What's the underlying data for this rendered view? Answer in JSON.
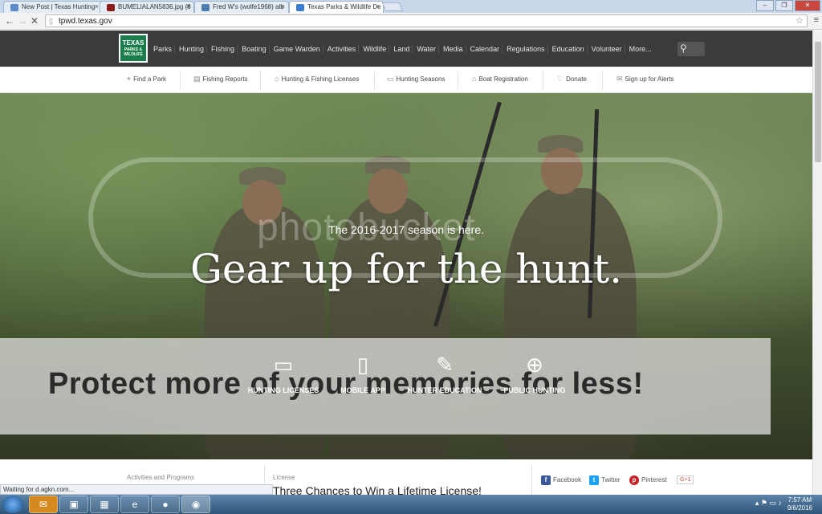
{
  "browser": {
    "tabs": [
      {
        "title": "New Post | Texas Hunting",
        "favicon_color": "#5c89c7"
      },
      {
        "title": "BUMELIALAN5836.jpg (8",
        "favicon_color": "#8b1b1b"
      },
      {
        "title": "Fred W's (wolfe1968) alb",
        "favicon_color": "#4c7fb2"
      },
      {
        "title": "Texas Parks & Wildlife De",
        "favicon_color": "#3a7bd5"
      }
    ],
    "url": "tpwd.texas.gov",
    "status_text": "Waiting for d.agkn.com..."
  },
  "site": {
    "logo": {
      "line1": "TEXAS",
      "line2": "PARKS &",
      "line3": "WILDLIFE"
    },
    "nav": [
      "Parks",
      "Hunting",
      "Fishing",
      "Boating",
      "Game Warden",
      "Activities",
      "Wildlife",
      "Land",
      "Water",
      "Media",
      "Calendar",
      "Regulations",
      "Education",
      "Volunteer",
      "More..."
    ],
    "quicklinks": [
      {
        "label": "Find a Park",
        "icon": "map-pin-icon"
      },
      {
        "label": "Fishing Reports",
        "icon": "document-icon"
      },
      {
        "label": "Hunting & Fishing Licenses",
        "icon": "tag-icon"
      },
      {
        "label": "Hunting Seasons",
        "icon": "calendar-icon"
      },
      {
        "label": "Boat Registration",
        "icon": "tag-icon"
      },
      {
        "label": "Donate",
        "icon": "heart-icon"
      },
      {
        "label": "Sign up for Alerts",
        "icon": "envelope-icon"
      }
    ]
  },
  "hero": {
    "subtitle": "The 2016-2017 season is here.",
    "title": "Gear up for the hunt.",
    "watermark": "photobucket",
    "banner": "Protect more of your memories for less!",
    "ctas": [
      {
        "label": "HUNTING LICENSES",
        "icon": "license-card-icon"
      },
      {
        "label": "MOBILE APP",
        "icon": "mobile-phone-icon"
      },
      {
        "label": "HUNTER EDUCATION",
        "icon": "pencil-edit-icon"
      },
      {
        "label": "PUBLIC HUNTING",
        "icon": "crosshair-icon"
      }
    ]
  },
  "lower": {
    "col_a": "Activities and Programs",
    "col_b_label": "License",
    "col_b_title": "Three Chances to Win a Lifetime License!",
    "social": [
      {
        "label": "Facebook",
        "color": "#3b5998"
      },
      {
        "label": "Twitter",
        "color": "#1da1f2"
      },
      {
        "label": "Pinterest",
        "color": "#cb2027"
      }
    ],
    "gplus": "G+1"
  },
  "taskbar": {
    "time": "7:57 AM",
    "date": "9/6/2016"
  }
}
